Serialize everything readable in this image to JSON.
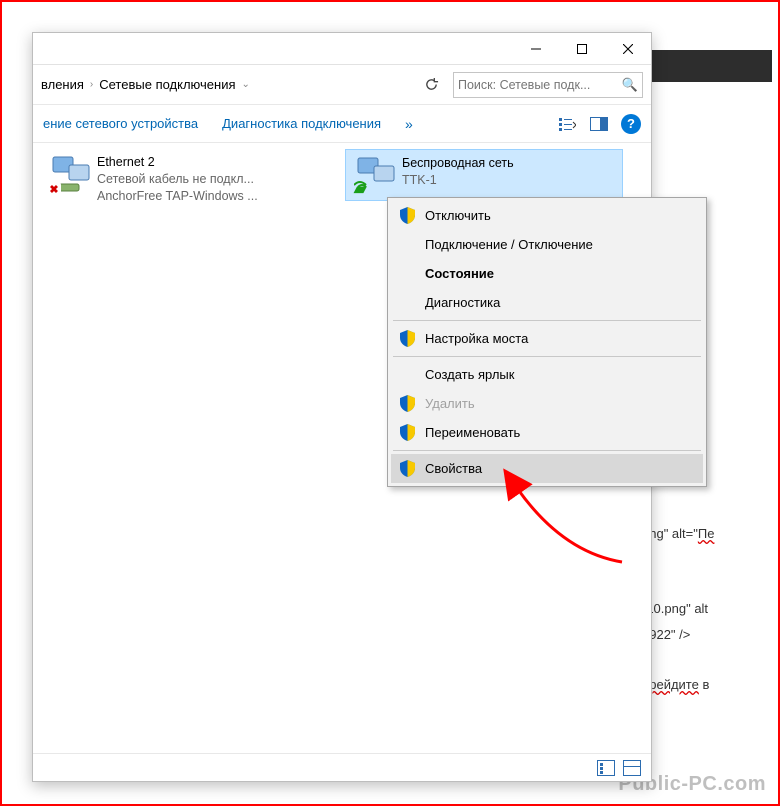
{
  "bg_code": {
    "l1a": "ong\" alt=\"",
    "l1b": "Пе",
    "l2": "-10.png\" alt",
    "l3": "1922\" />",
    "l4a": "ерейдите",
    "l4b": " в"
  },
  "watermark": "Public-PC.com",
  "breadcrumb": {
    "part1": "вления",
    "part2": "Сетевые подключения"
  },
  "search": {
    "placeholder": "Поиск: Сетевые подк..."
  },
  "toolbar": {
    "item1": "ение сетевого устройства",
    "item2": "Диагностика подключения",
    "more": "»"
  },
  "connections": [
    {
      "name": "Ethernet 2",
      "sub1": "Сетевой кабель не подкл...",
      "sub2": "AnchorFree TAP-Windows ..."
    },
    {
      "name": "Беспроводная сеть",
      "sub1": "TTK-1",
      "sub2": ""
    }
  ],
  "context_menu": {
    "items": [
      {
        "label": "Отключить",
        "shield": true
      },
      {
        "label": "Подключение / Отключение"
      },
      {
        "label": "Состояние",
        "bold": true
      },
      {
        "label": "Диагностика"
      },
      {
        "label": "Настройка моста",
        "shield": true
      },
      {
        "label": "Создать ярлык"
      },
      {
        "label": "Удалить",
        "shield": true,
        "disabled": true
      },
      {
        "label": "Переименовать",
        "shield": true
      },
      {
        "label": "Свойства",
        "shield": true,
        "hover": true
      }
    ]
  }
}
